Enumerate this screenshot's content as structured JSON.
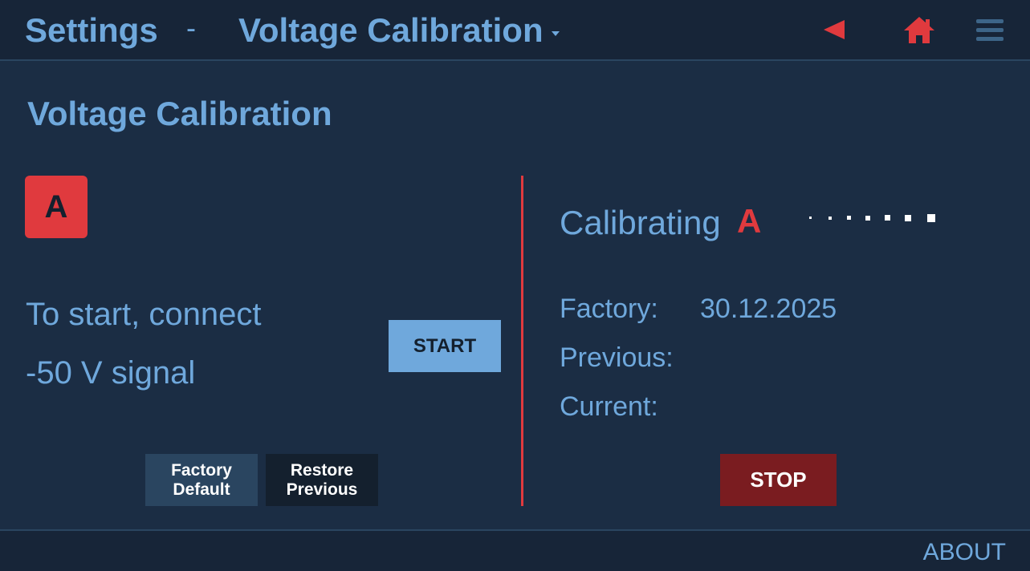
{
  "header": {
    "breadcrumb_root": "Settings",
    "separator": "-",
    "page_title": "Voltage Calibration",
    "icons": {
      "back": "back-arrow-icon",
      "home": "home-icon",
      "menu": "hamburger-menu-icon"
    }
  },
  "main": {
    "section_title": "Voltage Calibration",
    "channel_badge": "A",
    "instruction_line1": "To start, connect",
    "instruction_line2": "-50 V signal",
    "start_label": "START",
    "factory_default": {
      "line1": "Factory",
      "line2": "Default"
    },
    "restore_previous": {
      "line1": "Restore",
      "line2": "Previous"
    }
  },
  "status": {
    "calibrating_label": "Calibrating",
    "calibrating_channel": "A",
    "factory_label": "Factory:",
    "factory_value": "30.12.2025",
    "previous_label": "Previous:",
    "previous_value": "",
    "current_label": "Current:",
    "current_value": "",
    "stop_label": "STOP"
  },
  "footer": {
    "about_label": "ABOUT"
  },
  "colors": {
    "background": "#1b2d44",
    "bar": "#172538",
    "text": "#6fa8dc",
    "accent_red": "#e03a3e",
    "stop_red": "#7a1c20"
  }
}
